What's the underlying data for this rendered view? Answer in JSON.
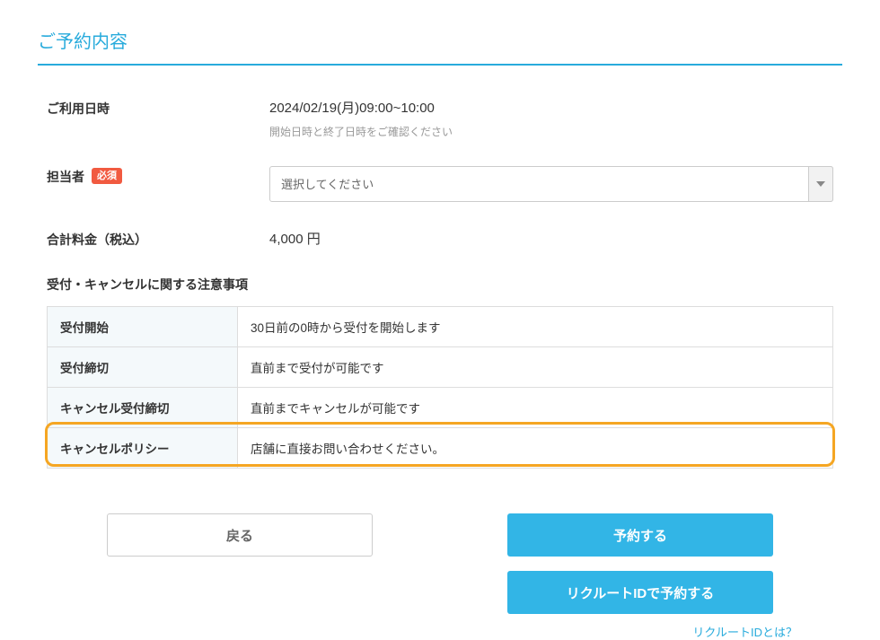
{
  "page_title": "ご予約内容",
  "form": {
    "datetime": {
      "label": "ご利用日時",
      "value": "2024/02/19(月)09:00~10:00",
      "note": "開始日時と終了日時をご確認ください"
    },
    "staff": {
      "label": "担当者",
      "required_badge": "必須",
      "placeholder": "選択してください"
    },
    "price": {
      "label": "合計料金（税込）",
      "value": "4,000 円"
    }
  },
  "notice": {
    "heading": "受付・キャンセルに関する注意事項",
    "rows": [
      {
        "label": "受付開始",
        "value": "30日前の0時から受付を開始します"
      },
      {
        "label": "受付締切",
        "value": "直前まで受付が可能です"
      },
      {
        "label": "キャンセル受付締切",
        "value": "直前までキャンセルが可能です"
      },
      {
        "label": "キャンセルポリシー",
        "value": "店舗に直接お問い合わせください。"
      }
    ]
  },
  "buttons": {
    "back": "戻る",
    "reserve": "予約する",
    "reserve_recruit": "リクルートIDで予約する"
  },
  "help_link": "リクルートIDとは？"
}
